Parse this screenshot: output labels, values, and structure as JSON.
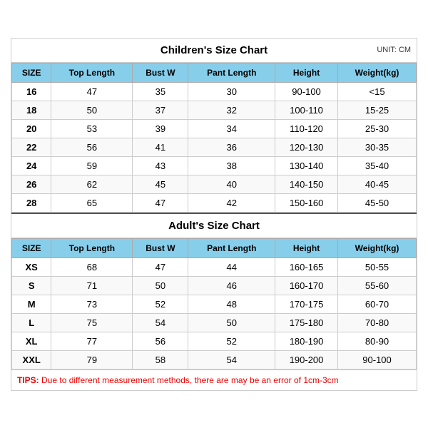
{
  "children_section": {
    "title": "Children's Size Chart",
    "unit": "UNIT: CM",
    "headers": [
      "SIZE",
      "Top Length",
      "Bust W",
      "Pant Length",
      "Height",
      "Weight(kg)"
    ],
    "rows": [
      [
        "16",
        "47",
        "35",
        "30",
        "90-100",
        "<15"
      ],
      [
        "18",
        "50",
        "37",
        "32",
        "100-110",
        "15-25"
      ],
      [
        "20",
        "53",
        "39",
        "34",
        "110-120",
        "25-30"
      ],
      [
        "22",
        "56",
        "41",
        "36",
        "120-130",
        "30-35"
      ],
      [
        "24",
        "59",
        "43",
        "38",
        "130-140",
        "35-40"
      ],
      [
        "26",
        "62",
        "45",
        "40",
        "140-150",
        "40-45"
      ],
      [
        "28",
        "65",
        "47",
        "42",
        "150-160",
        "45-50"
      ]
    ]
  },
  "adult_section": {
    "title": "Adult's Size Chart",
    "headers": [
      "SIZE",
      "Top Length",
      "Bust W",
      "Pant Length",
      "Height",
      "Weight(kg)"
    ],
    "rows": [
      [
        "XS",
        "68",
        "47",
        "44",
        "160-165",
        "50-55"
      ],
      [
        "S",
        "71",
        "50",
        "46",
        "160-170",
        "55-60"
      ],
      [
        "M",
        "73",
        "52",
        "48",
        "170-175",
        "60-70"
      ],
      [
        "L",
        "75",
        "54",
        "50",
        "175-180",
        "70-80"
      ],
      [
        "XL",
        "77",
        "56",
        "52",
        "180-190",
        "80-90"
      ],
      [
        "XXL",
        "79",
        "58",
        "54",
        "190-200",
        "90-100"
      ]
    ]
  },
  "tips": {
    "label": "TIPS:",
    "text": " Due to different measurement methods, there are may be an error of 1cm-3cm"
  }
}
